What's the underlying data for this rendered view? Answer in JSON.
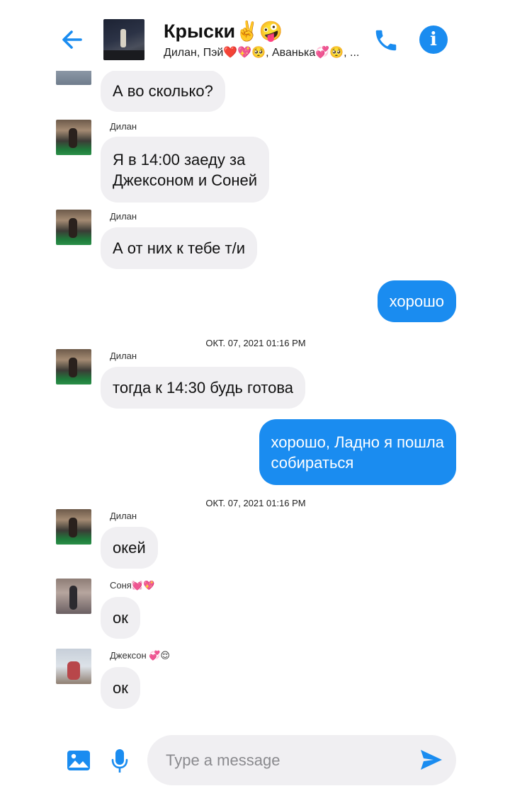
{
  "header": {
    "title": "Крыски✌️🤪",
    "subtitle": "Дилан, Пэй❤️💖🥺, Аванька💞🥺, ..."
  },
  "messages": {
    "m1": {
      "text": "А во сколько?"
    },
    "m2": {
      "sender": "Дилан",
      "text_line1": "Я в 14:00 заеду за",
      "text_line2": "Джексоном и Соней"
    },
    "m3": {
      "sender": "Дилан",
      "text": "А от них к тебе т/и"
    },
    "m4": {
      "text": "хорошо"
    },
    "ts1": "ОКТ. 07, 2021 01:16 PM",
    "m5": {
      "sender": "Дилан",
      "text": "тогда к 14:30 будь готова"
    },
    "m6": {
      "text_line1": "хорошо, Ладно я пошла",
      "text_line2": "собираться"
    },
    "ts2": "ОКТ. 07, 2021 01:16 PM",
    "m7": {
      "sender": "Дилан",
      "text": "окей"
    },
    "m8": {
      "sender": "Соня💓💖",
      "text": "ок"
    },
    "m9": {
      "sender": "Джексон 💞😌",
      "text": "ок"
    }
  },
  "composer": {
    "placeholder": "Type a message"
  },
  "colors": {
    "accent": "#1a8cf0",
    "incoming_bubble": "#f0eff2",
    "outgoing_text": "#ffffff"
  },
  "icons": [
    "back-arrow-icon",
    "phone-icon",
    "info-icon",
    "image-icon",
    "microphone-icon",
    "send-icon"
  ]
}
